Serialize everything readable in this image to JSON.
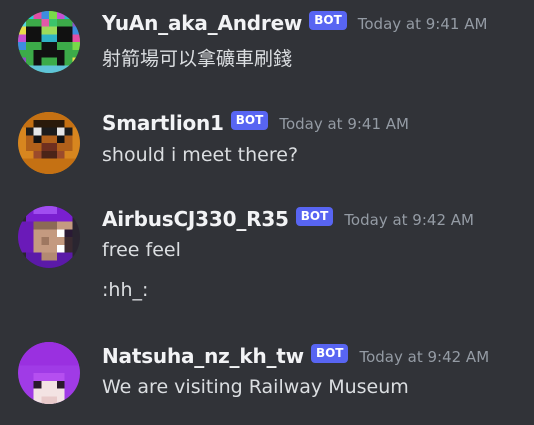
{
  "messages": [
    {
      "username": "YuAn_aka_Andrew",
      "badge": "BOT",
      "timestamp": "Today at 9:41 AM",
      "lines": [
        "射箭場可以拿礦車刷錢"
      ]
    },
    {
      "username": "Smartlion1",
      "badge": "BOT",
      "timestamp": "Today at 9:41 AM",
      "lines": [
        "should i meet there?"
      ]
    },
    {
      "username": "AirbusCJ330_R35",
      "badge": "BOT",
      "timestamp": "Today at 9:42 AM",
      "lines": [
        "free feel",
        ":hh_:"
      ]
    },
    {
      "username": "Natsuha_nz_kh_tw",
      "badge": "BOT",
      "timestamp": "Today at 9:42 AM",
      "lines": [
        "We are visiting Railway Museum"
      ]
    }
  ],
  "colors": {
    "background": "#313338",
    "username": "#f2f3f5",
    "message_text": "#dbdee1",
    "timestamp": "#949ba4",
    "bot_badge": "#5865f2"
  }
}
